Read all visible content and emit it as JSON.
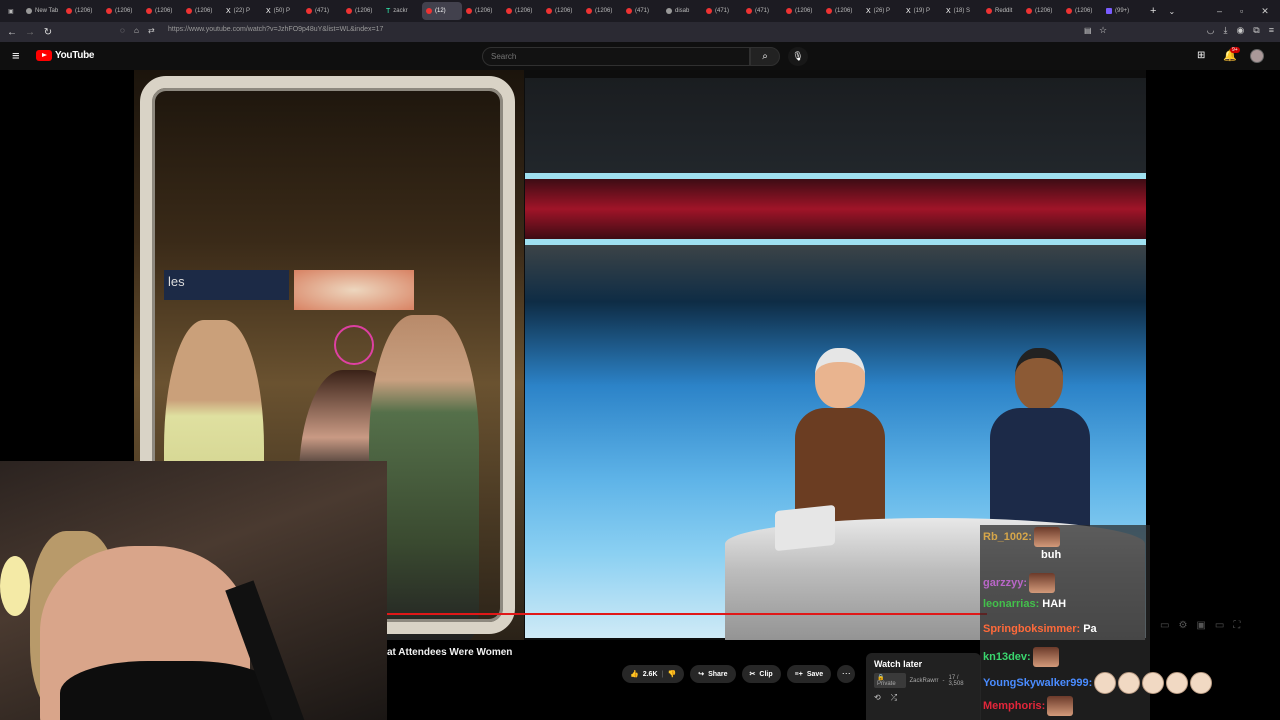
{
  "browser": {
    "tabs": [
      {
        "label": "New Tab",
        "icon": "grey"
      },
      {
        "label": "(1206)",
        "icon": "yt"
      },
      {
        "label": "(1206)",
        "icon": "yt"
      },
      {
        "label": "(1206)",
        "icon": "yt"
      },
      {
        "label": "(1206)",
        "icon": "yt"
      },
      {
        "label": "(22) P",
        "icon": "x"
      },
      {
        "label": "(50) P",
        "icon": "x"
      },
      {
        "label": "(471)",
        "icon": "yt"
      },
      {
        "label": "(1206)",
        "icon": "yt"
      },
      {
        "label": "zackr",
        "icon": "tt"
      },
      {
        "label": "(12)",
        "icon": "yt",
        "active": true
      },
      {
        "label": "(1206)",
        "icon": "yt"
      },
      {
        "label": "(1206)",
        "icon": "yt"
      },
      {
        "label": "(1206)",
        "icon": "yt"
      },
      {
        "label": "(1206)",
        "icon": "yt"
      },
      {
        "label": "(471)",
        "icon": "yt"
      },
      {
        "label": "disab",
        "icon": "grey"
      },
      {
        "label": "(471)",
        "icon": "yt"
      },
      {
        "label": "(471)",
        "icon": "yt"
      },
      {
        "label": "(1206)",
        "icon": "yt"
      },
      {
        "label": "(1206)",
        "icon": "yt"
      },
      {
        "label": "(26) P",
        "icon": "x"
      },
      {
        "label": "(19) P",
        "icon": "x"
      },
      {
        "label": "(18) S",
        "icon": "x"
      },
      {
        "label": "Reddit",
        "icon": "yt"
      },
      {
        "label": "(1206)",
        "icon": "yt"
      },
      {
        "label": "(1206)",
        "icon": "yt"
      },
      {
        "label": "(99+)",
        "icon": "purple"
      }
    ],
    "url": "https://www.youtube.com/watch?v=JzhFO9p48uY&list=WL&index=17"
  },
  "youtube": {
    "logo_text": "YouTube",
    "search_placeholder": "Search",
    "notification_count": "9+"
  },
  "video": {
    "title_fragment": "at Attendees Were Women",
    "shop_sign": "les",
    "progress": 0.62
  },
  "actions": {
    "likes": "2.6K",
    "share": "Share",
    "clip": "Clip",
    "save": "Save"
  },
  "playlist": {
    "title": "Watch later",
    "privacy": "Private",
    "owner": "ZackRawrr",
    "position": "17 / 3,508"
  },
  "chat": [
    {
      "user": "Rb_1002:",
      "color": "#d6a64a",
      "emote": true,
      "message": ""
    },
    {
      "user": "",
      "color": "#ffffff",
      "emote": false,
      "message": "buh"
    },
    {
      "user": "garzzyy:",
      "color": "#b966c8",
      "emote": true,
      "message": ""
    },
    {
      "user": "leonarrias:",
      "color": "#43c04b",
      "emote": false,
      "message": "HAH"
    },
    {
      "user": "Springboksimmer:",
      "color": "#ff6a3a",
      "emote": false,
      "message": "Pa"
    },
    {
      "user": "kn13dev:",
      "color": "#3ad66e",
      "emote": true,
      "message": ""
    },
    {
      "user": "YoungSkywalker999:",
      "color": "#4a8cff",
      "emote": false,
      "message": ""
    },
    {
      "user": "Memphoris:",
      "color": "#e2263a",
      "emote": true,
      "message": ""
    }
  ],
  "colors": {
    "yt_red": "#ff0000",
    "progress_red": "#e01818"
  }
}
